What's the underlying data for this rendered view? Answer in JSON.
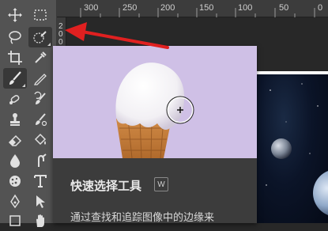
{
  "ruler": {
    "top_labels": [
      "300",
      "250",
      "200",
      "150",
      "100",
      "50",
      "0"
    ],
    "left_chars": [
      "2",
      "0",
      "0"
    ]
  },
  "toolbar": {
    "tools": [
      {
        "name": "move-tool",
        "icon": "move-icon",
        "active": false
      },
      {
        "name": "rectangular-marquee-tool",
        "icon": "marquee-icon",
        "active": false
      },
      {
        "name": "lasso-tool",
        "icon": "lasso-icon",
        "active": false
      },
      {
        "name": "quick-selection-tool",
        "icon": "quick-selection-icon",
        "active": true
      },
      {
        "name": "crop-tool",
        "icon": "crop-icon",
        "active": false
      },
      {
        "name": "eyedropper-tool",
        "icon": "eyedropper-icon",
        "active": false
      },
      {
        "name": "brush-tool",
        "icon": "brush-icon",
        "active": true
      },
      {
        "name": "pencil-tool",
        "icon": "pencil-icon",
        "active": false
      },
      {
        "name": "healing-brush-tool",
        "icon": "healing-icon",
        "active": false
      },
      {
        "name": "history-brush-tool",
        "icon": "history-brush-icon",
        "active": false
      },
      {
        "name": "clone-stamp-tool",
        "icon": "stamp-icon",
        "active": false
      },
      {
        "name": "mixer-brush-tool",
        "icon": "mixer-brush-icon",
        "active": false
      },
      {
        "name": "eraser-tool",
        "icon": "eraser-icon",
        "active": false
      },
      {
        "name": "paint-bucket-tool",
        "icon": "bucket-icon",
        "active": false
      },
      {
        "name": "blur-tool",
        "icon": "drop-icon",
        "active": false
      },
      {
        "name": "smudge-tool",
        "icon": "smudge-icon",
        "active": false
      },
      {
        "name": "sponge-tool",
        "icon": "sponge-icon",
        "active": false
      },
      {
        "name": "type-tool",
        "icon": "type-icon",
        "active": false
      },
      {
        "name": "pen-tool",
        "icon": "pen-icon",
        "active": false
      },
      {
        "name": "path-selection-tool",
        "icon": "arrow-icon",
        "active": false
      },
      {
        "name": "hand-tool",
        "icon": "hand-icon",
        "active": false
      }
    ]
  },
  "tooltip": {
    "title": "快速选择工具",
    "shortcut": "W",
    "description": "通过查找和追踪图像中的边缘来"
  },
  "colors": {
    "accent_arrow": "#e02020",
    "tooltip_image_bg": "#cfc0e6",
    "tooltip_bg": "#3c3c3c",
    "toolbar_bg": "#535353"
  }
}
